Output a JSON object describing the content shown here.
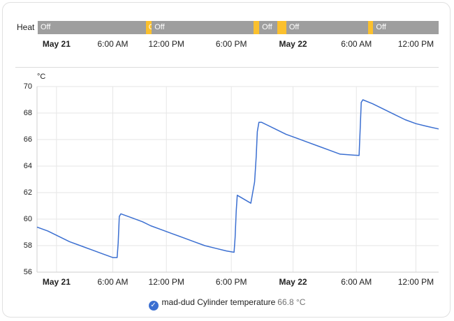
{
  "timeline": {
    "entity_label": "Heat",
    "segments": [
      {
        "state": "Off",
        "from": 0.0,
        "to": 20.0
      },
      {
        "state": "On",
        "from": 20.0,
        "to": 21.1
      },
      {
        "state": "Off",
        "from": 21.1,
        "to": 39.9
      },
      {
        "state": "",
        "from": 39.9,
        "to": 41.0
      },
      {
        "state": "Off",
        "from": 41.0,
        "to": 44.4
      },
      {
        "state": "",
        "from": 44.4,
        "to": 46.0
      },
      {
        "state": "Off",
        "from": 46.0,
        "to": 61.2
      },
      {
        "state": "",
        "from": 61.2,
        "to": 62.1
      },
      {
        "state": "Off",
        "from": 62.1,
        "to": 74.2
      }
    ],
    "colors": {
      "Off": "#9e9e9e",
      "On": "#fbc02d"
    }
  },
  "x_axis": {
    "start_hours": 0,
    "end_hours": 74.2,
    "ticks": [
      {
        "label": "May 21",
        "at": 3.6,
        "bold": true
      },
      {
        "label": "6:00 AM",
        "at": 14.0,
        "bold": false
      },
      {
        "label": "12:00 PM",
        "at": 23.9,
        "bold": false
      },
      {
        "label": "6:00 PM",
        "at": 35.9,
        "bold": false
      },
      {
        "label": "May 22",
        "at": 47.3,
        "bold": true
      },
      {
        "label": "6:00 AM",
        "at": 59.0,
        "bold": false
      },
      {
        "label": "12:00 PM",
        "at": 70.0,
        "bold": false
      }
    ]
  },
  "chart_data": {
    "type": "line",
    "ylabel": "°C",
    "ylim": [
      56,
      70
    ],
    "yticks": [
      56,
      58,
      60,
      62,
      64,
      66,
      68,
      70
    ],
    "grid": true,
    "legend_position": "bottom-center",
    "series": [
      {
        "name": "mad-dud Cylinder temperature",
        "color": "#3b6fd1",
        "x": [
          0,
          2,
          4,
          6,
          8,
          10,
          12,
          14,
          14.8,
          15.0,
          15.2,
          15.5,
          17.5,
          19.5,
          21,
          23,
          25,
          27,
          29,
          31,
          33,
          35,
          36.4,
          36.6,
          36.8,
          37.0,
          39.5,
          40.2,
          40.5,
          40.7,
          41.0,
          41.5,
          44,
          46,
          48,
          50,
          52,
          54,
          56,
          59.5,
          59.7,
          59.9,
          60.2,
          62,
          64,
          66,
          68,
          70,
          72,
          74.2
        ],
        "y": [
          59.4,
          59.1,
          58.7,
          58.3,
          58.0,
          57.7,
          57.4,
          57.1,
          57.1,
          58.2,
          60.2,
          60.4,
          60.1,
          59.8,
          59.5,
          59.2,
          58.9,
          58.6,
          58.3,
          58.0,
          57.8,
          57.6,
          57.5,
          58.6,
          60.6,
          61.8,
          61.2,
          62.8,
          64.7,
          66.6,
          67.3,
          67.3,
          66.8,
          66.4,
          66.1,
          65.8,
          65.5,
          65.2,
          64.9,
          64.8,
          66.7,
          68.8,
          69.0,
          68.7,
          68.3,
          67.9,
          67.5,
          67.2,
          67.0,
          66.8
        ]
      }
    ]
  },
  "legend": {
    "name": "mad-dud Cylinder temperature",
    "value": "66.8 °C"
  }
}
